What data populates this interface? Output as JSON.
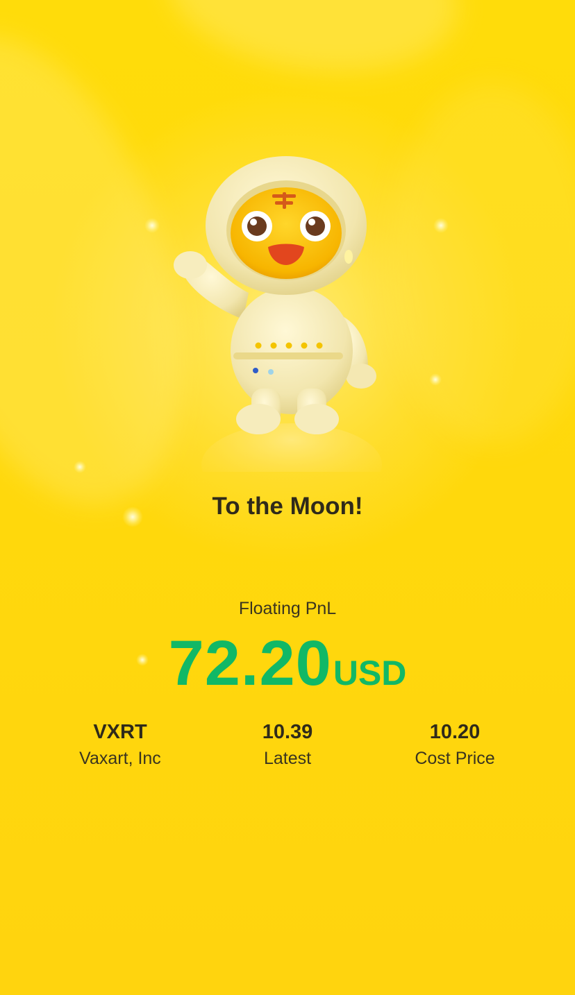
{
  "headline": "To the Moon!",
  "pnl": {
    "label": "Floating PnL",
    "amount": "72.20",
    "currency": "USD",
    "color": "#11B866"
  },
  "stats": [
    {
      "value": "VXRT",
      "label": "Vaxart, Inc"
    },
    {
      "value": "10.39",
      "label": "Latest"
    },
    {
      "value": "10.20",
      "label": "Cost Price"
    }
  ],
  "colors": {
    "background": "#FFD90C",
    "text_dark": "#2f2a1a",
    "gain_green": "#11B866"
  },
  "illustration": {
    "name": "astronaut-tiger-mascot"
  }
}
